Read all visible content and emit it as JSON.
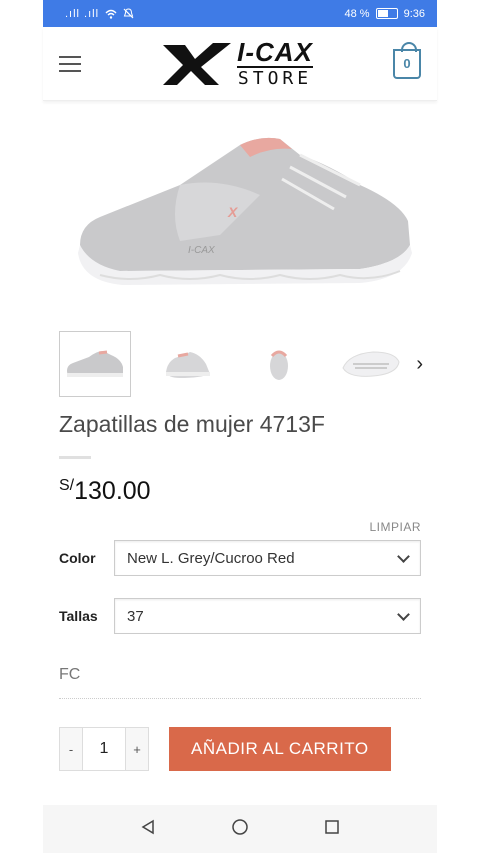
{
  "status_bar": {
    "signal": ".ıll .ıll",
    "battery": "48 %",
    "time": "9:36"
  },
  "header": {
    "logo_main": "I-CAX",
    "logo_sub": "STORE",
    "cart_count": "0"
  },
  "product": {
    "title": "Zapatillas de mujer 4713F",
    "price_currency": "S/",
    "price_amount": "130.00",
    "clear_label": "LIMPIAR",
    "color_label": "Color",
    "color_value": "New L. Grey/Cucroo Red",
    "size_label": "Tallas",
    "size_value": "37",
    "sku": "FC",
    "quantity": "1",
    "minus": "-",
    "plus": "+",
    "add_to_cart": "AÑADIR AL CARRITO"
  },
  "colors": {
    "accent": "#d9694a",
    "status_bar": "#3f7be6",
    "cart": "#4a86a8"
  },
  "icons": [
    "menu-icon",
    "cart-icon",
    "chevron-right-icon",
    "back-icon",
    "home-icon",
    "recents-icon"
  ]
}
